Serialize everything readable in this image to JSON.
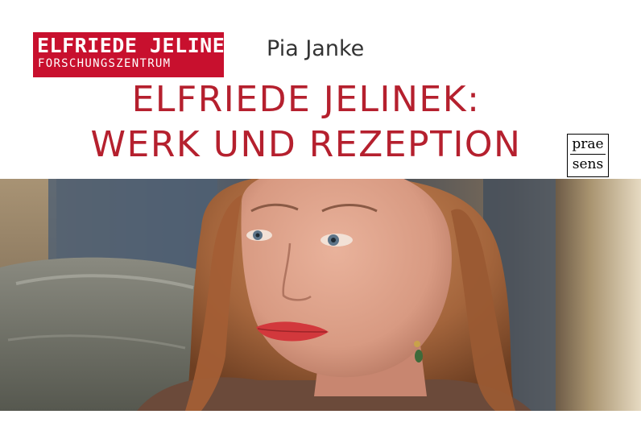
{
  "logo": {
    "line1": "ELFRIEDE JELINEK",
    "line2": "FORSCHUNGSZENTRUM"
  },
  "author": "Pia Janke",
  "title": {
    "line1": "ELFRIEDE JELINEK:",
    "line2": "WERK UND REZEPTION"
  },
  "publisher": {
    "line1": "prae",
    "line2": "sens"
  },
  "colors": {
    "brand_red": "#c8102e",
    "title_red": "#b5202e"
  }
}
